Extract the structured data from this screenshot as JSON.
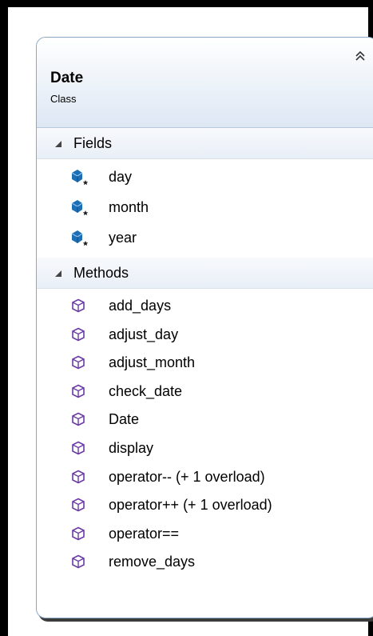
{
  "class_box": {
    "title": "Date",
    "subtitle": "Class",
    "collapse_icon": "double-chevron-up-icon"
  },
  "sections": {
    "fields": {
      "label": "Fields",
      "items": [
        "day",
        "month",
        "year"
      ]
    },
    "methods": {
      "label": "Methods",
      "items": [
        "add_days",
        "adjust_day",
        "adjust_month",
        "check_date",
        "Date",
        "display",
        "operator-- (+ 1 overload)",
        "operator++ (+ 1 overload)",
        "operator==",
        "remove_days"
      ]
    }
  },
  "colors": {
    "field_icon": "#1c6fb5",
    "method_icon": "#6a3aa5",
    "card_border": "#8aa7c4"
  }
}
